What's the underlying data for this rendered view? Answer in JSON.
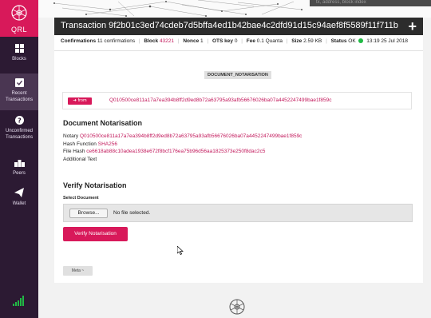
{
  "sidebar": {
    "logo_text": "QRL",
    "items": [
      {
        "label": "Blocks",
        "icon": "blocks-icon"
      },
      {
        "label": "Recent Transactions",
        "icon": "checkbox-icon"
      },
      {
        "label": "Unconfirmed Transactions",
        "icon": "question-icon"
      },
      {
        "label": "Peers",
        "icon": "peers-icon"
      },
      {
        "label": "Wallet",
        "icon": "paper-plane-icon"
      }
    ]
  },
  "search": {
    "placeholder": "tx, address, block index"
  },
  "transaction": {
    "title": "Transaction 9f2b01c3ed74cdeb7d5bffa4ed1b42bae4c2dfd91d15c94aef8f5589f11f711b",
    "confirmations_label": "Confirmations",
    "confirmations_value": "11 confirmations",
    "block_label": "Block",
    "block_value": "43221",
    "nonce_label": "Nonce",
    "nonce_value": "1",
    "ots_label": "OTS key",
    "ots_value": "0",
    "fee_label": "Fee",
    "fee_value": "0.1 Quanta",
    "size_label": "Size",
    "size_value": "2.59 KB",
    "status_label": "Status",
    "status_value": "OK",
    "timestamp": "13:19 25 Jul 2018",
    "status_color": "#21ba45"
  },
  "type_badge": "DOCUMENT_NOTARISATION",
  "from": {
    "badge": "from",
    "address": "Q010500ce811a17a7ea394b8ff2d9ed8b72a63795a93afb56676026ba07a4452247499bae1f859c"
  },
  "notarisation": {
    "title": "Document Notarisation",
    "notary_label": "Notary",
    "notary_value": "Q010500ce811a17a7ea394b8ff2d9ed8b72a63795a93afb56676026ba07a4452247499bae1f859c",
    "hash_function_label": "Hash Function",
    "hash_function_value": "SHA256",
    "file_hash_label": "File Hash",
    "file_hash_value": "ce6618ab88c10adea1938e672f8bcf176ea75b96d56aa1825373e250f8dac2c5",
    "additional_text_label": "Additional Text"
  },
  "verify": {
    "title": "Verify Notarisation",
    "select_label": "Select Document",
    "browse_label": "Browse...",
    "no_file_text": "No file selected.",
    "verify_button": "Verify Notarisation"
  },
  "meta_button": "Meta ~",
  "colors": {
    "accent": "#d8195a",
    "sidebar": "#2c1a33",
    "header": "#2c2c2c"
  }
}
